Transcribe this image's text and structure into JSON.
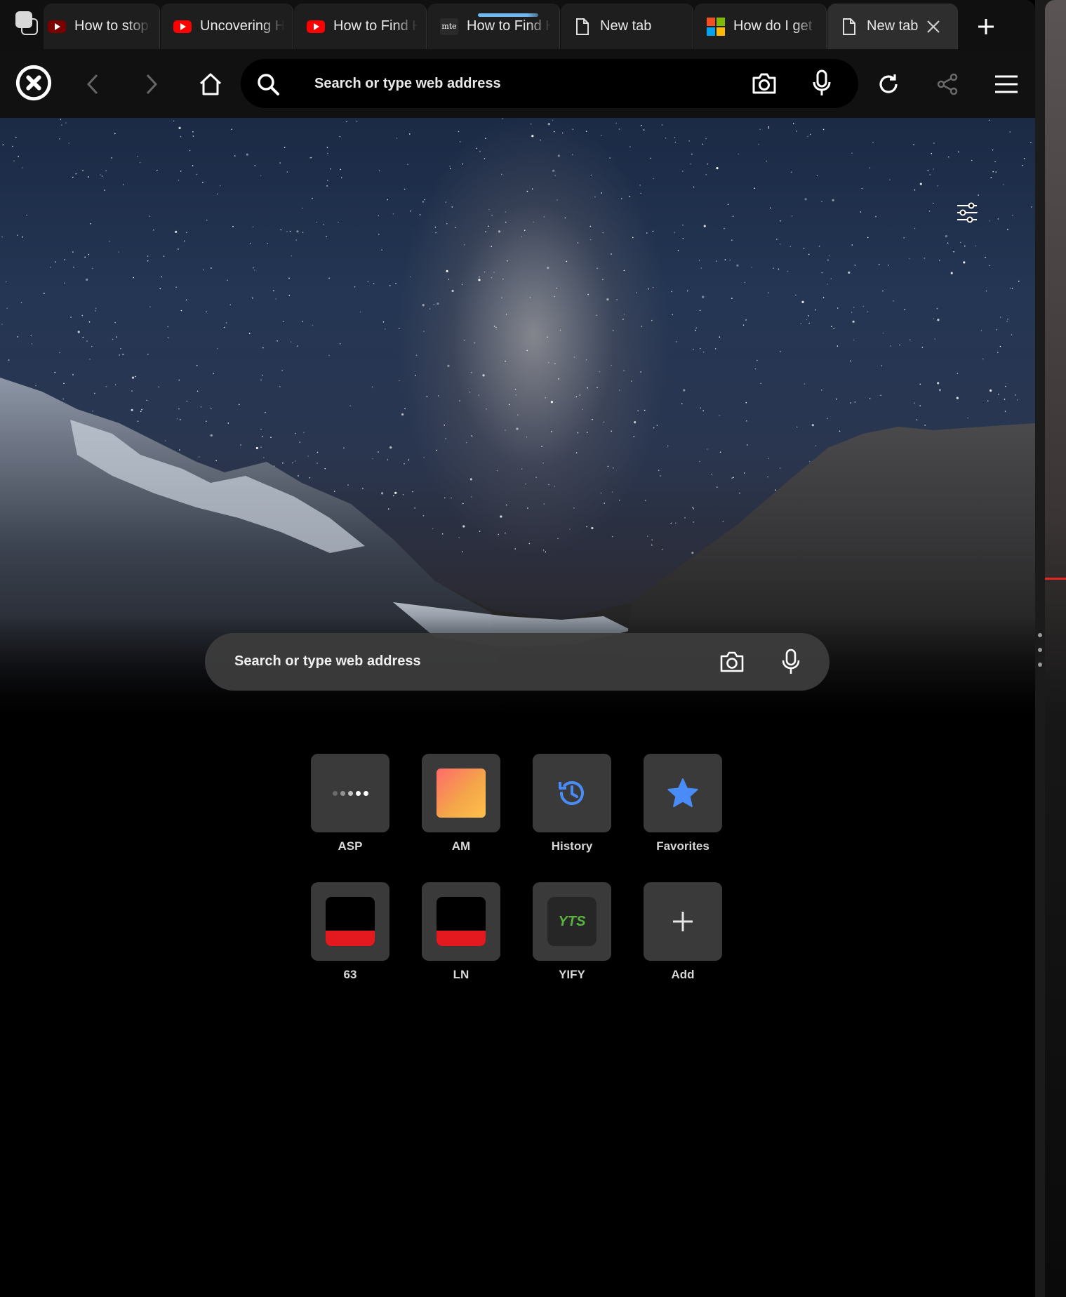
{
  "tabs": [
    {
      "title": "How to stop Y",
      "favicon": "youtube-icon-dim",
      "active": false
    },
    {
      "title": "Uncovering H",
      "favicon": "youtube-icon",
      "active": false
    },
    {
      "title": "How to Find H",
      "favicon": "youtube-icon",
      "active": false
    },
    {
      "title": "How to Find H",
      "favicon": "mte-icon",
      "favicon_text": "mte",
      "active": false,
      "loading": true
    },
    {
      "title": "New tab",
      "favicon": "document-icon",
      "active": false
    },
    {
      "title": "How do I get",
      "favicon": "microsoft-icon",
      "active": false
    },
    {
      "title": "New tab",
      "favicon": "document-icon",
      "active": true
    }
  ],
  "toolbar": {
    "omnibox_placeholder": "Search or type web address"
  },
  "hero": {
    "search_placeholder": "Search or type web address"
  },
  "speed_dial": [
    {
      "label": "ASP",
      "thumb": "asp"
    },
    {
      "label": "AM",
      "thumb": "am"
    },
    {
      "label": "History",
      "thumb": "history-icon"
    },
    {
      "label": "Favorites",
      "thumb": "star-icon"
    },
    {
      "label": "63",
      "thumb": "red"
    },
    {
      "label": "LN",
      "thumb": "red"
    },
    {
      "label": "YIFY",
      "thumb": "yts",
      "thumb_text": "YTS"
    },
    {
      "label": "Add",
      "thumb": "plus-icon"
    }
  ],
  "colors": {
    "accent_blue": "#4a8cf7",
    "loading_bar": "#6db9f0",
    "tile_bg": "#3a3a3a",
    "youtube_red": "#ff0000"
  }
}
